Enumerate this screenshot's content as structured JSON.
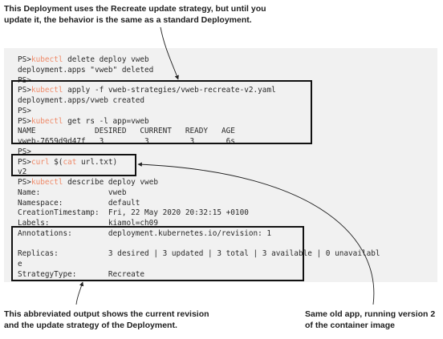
{
  "callouts": {
    "top": [
      "This Deployment uses the Recreate update strategy, but until you",
      "update it, the behavior is the same as a standard Deployment."
    ],
    "bottom_left": [
      "This abbreviated output shows the current revision",
      "and the update strategy of the Deployment."
    ],
    "bottom_right": [
      "Same old app, running version 2",
      "of the container image"
    ]
  },
  "terminal": {
    "prompt": "PS>",
    "lines": [
      {
        "prompt": "PS>",
        "cmd": "kubectl",
        "args": " delete deploy vweb"
      },
      {
        "text": "deployment.apps \"vweb\" deleted"
      },
      {
        "prompt": "PS>"
      },
      {
        "prompt": "PS>",
        "cmd": "kubectl",
        "args": " apply -f vweb-strategies/vweb-recreate-v2.yaml"
      },
      {
        "text": "deployment.apps/vweb created"
      },
      {
        "prompt": "PS>"
      },
      {
        "prompt": "PS>",
        "cmd": "kubectl",
        "args": " get rs -l app=vweb"
      },
      {
        "text": "NAME             DESIRED   CURRENT   READY   AGE"
      },
      {
        "text": "vweb-7659d9d47f   3         3         3       6s"
      },
      {
        "prompt": "PS>"
      },
      {
        "prompt": "PS>",
        "cmd": "curl",
        "args": " $(",
        "cmd2": "cat",
        "args2": " url.txt)"
      },
      {
        "text": "v2"
      },
      {
        "prompt": "PS>",
        "cmd": "kubectl",
        "args": " describe deploy vweb"
      },
      {
        "text": "Name:               vweb"
      },
      {
        "text": "Namespace:          default"
      },
      {
        "text": "CreationTimestamp:  Fri, 22 May 2020 20:32:15 +0100"
      },
      {
        "text": "Labels:             kiamol=ch09"
      },
      {
        "text": "Annotations:        deployment.kubernetes.io/revision: 1"
      },
      {
        "text": ""
      },
      {
        "text": "Replicas:           3 desired | 3 updated | 3 total | 3 available | 0 unavailabl"
      },
      {
        "text": "e"
      },
      {
        "text": "StrategyType:       Recreate"
      }
    ]
  }
}
